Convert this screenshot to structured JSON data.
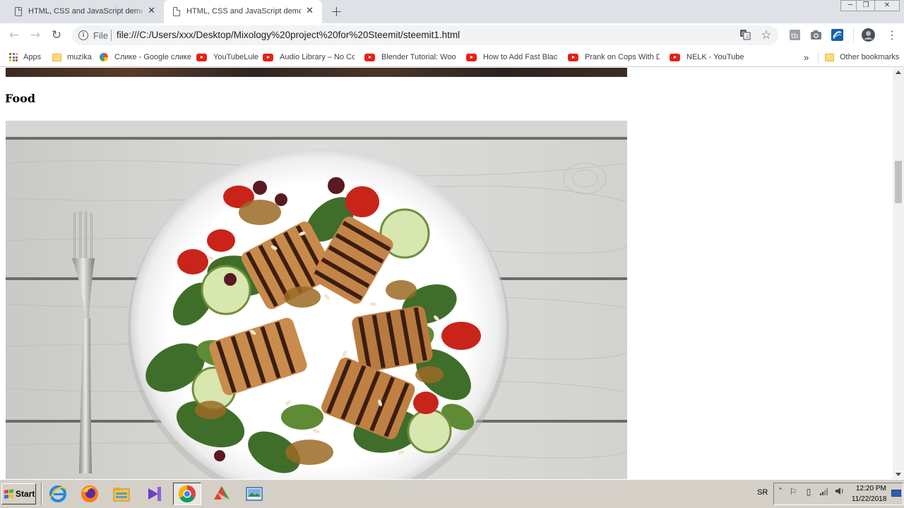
{
  "browser": {
    "tabs": [
      {
        "title": "HTML, CSS and JavaScript demo - Li",
        "active": false,
        "close": "✕"
      },
      {
        "title": "HTML, CSS and JavaScript demo",
        "active": true,
        "close": "✕"
      }
    ],
    "new_tab": "+",
    "window_controls": {
      "minimize": "─",
      "restore": "❐",
      "close": "✕"
    },
    "nav": {
      "back": "←",
      "forward": "→",
      "reload": "↻"
    },
    "omnibox": {
      "info": "i",
      "scheme": "File",
      "url": "file:///C:/Users/xxx/Desktop/Mixology%20project%20for%20Steemit/steemit1.html",
      "translate_icon": "translate-icon",
      "star": "☆"
    },
    "menu": "⋮",
    "bookmarks": [
      {
        "label": "Apps",
        "icon": "apps-icon"
      },
      {
        "label": "muzika",
        "icon": "folder-icon"
      },
      {
        "label": "Слике - Google слике",
        "icon": "photos-icon"
      },
      {
        "label": "YouTubeLule",
        "icon": "youtube-icon"
      },
      {
        "label": "Audio Library – No Cop",
        "icon": "youtube-icon"
      },
      {
        "label": "Blender Tutorial: Wood",
        "icon": "youtube-icon"
      },
      {
        "label": "How to Add Fast Black I",
        "icon": "youtube-icon"
      },
      {
        "label": "Prank on Cops With Do",
        "icon": "youtube-icon"
      },
      {
        "label": "NELK - YouTube",
        "icon": "youtube-icon"
      }
    ],
    "bookmarks_overflow": "»",
    "other_bookmarks": "Other bookmarks"
  },
  "page": {
    "section_heading": "Food",
    "image_alt": "Grilled halloumi salad with spinach, tomatoes and cucumber on a white plate with a fork on wooden table"
  },
  "taskbar": {
    "start": "Start",
    "apps": [
      {
        "name": "internet-explorer",
        "pressed": false
      },
      {
        "name": "firefox",
        "pressed": false
      },
      {
        "name": "file-explorer",
        "pressed": false
      },
      {
        "name": "visual-studio",
        "pressed": false
      },
      {
        "name": "chrome",
        "pressed": true
      },
      {
        "name": "app-color",
        "pressed": false
      },
      {
        "name": "image-viewer",
        "pressed": false
      }
    ],
    "language": "SR",
    "time": "12:20 PM",
    "date": "11/22/2018"
  },
  "colors": {
    "tabstrip": "#dee1e6",
    "youtube_red": "#e62117",
    "taskbar": "#d4d0c8"
  }
}
